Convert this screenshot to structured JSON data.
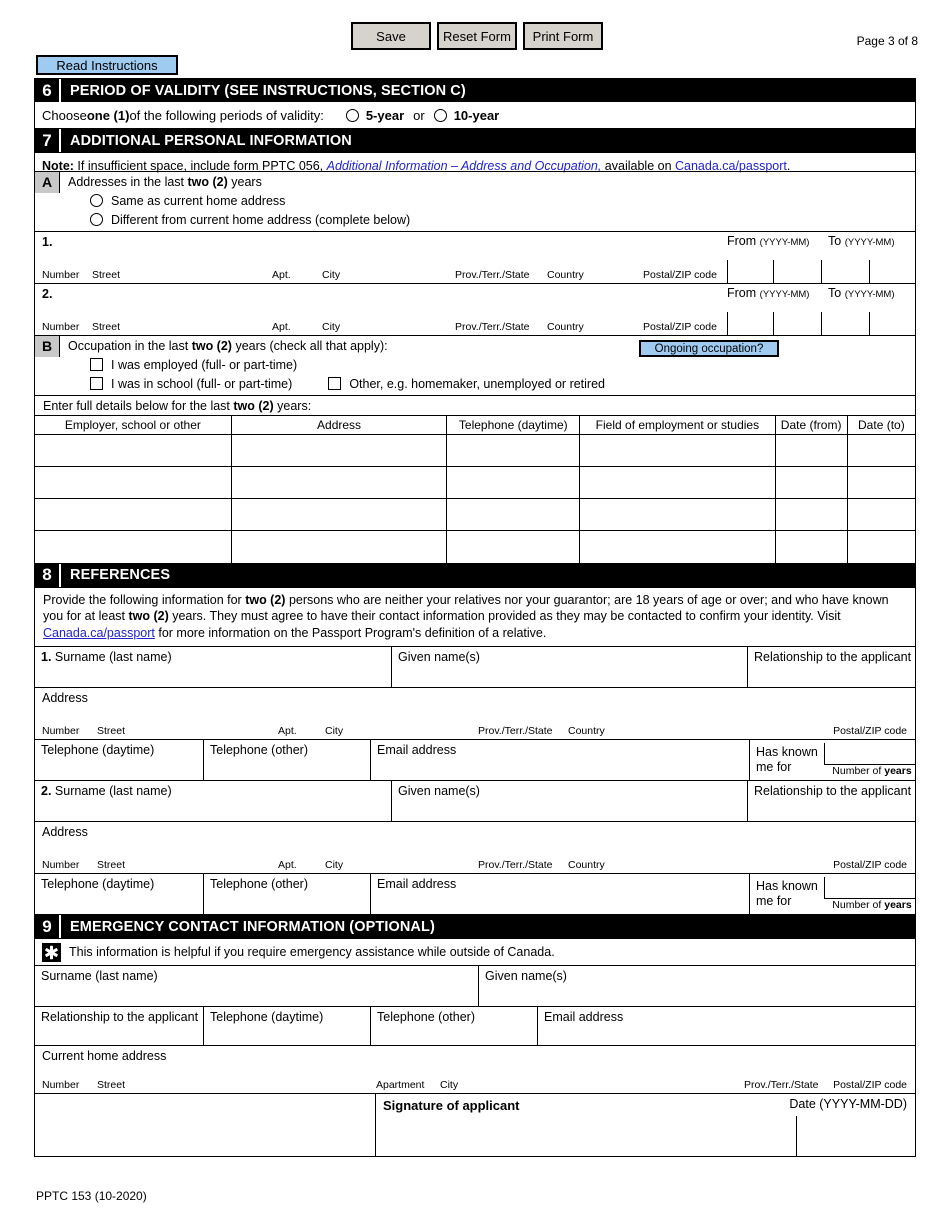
{
  "toolbar": {
    "save_label": "Save",
    "reset_label": "Reset Form",
    "print_label": "Print Form"
  },
  "header": {
    "page_indicator": "Page 3 of 8",
    "read_instructions_label": "Read Instructions"
  },
  "section6": {
    "number": "6",
    "title": "PERIOD OF VALIDITY (SEE INSTRUCTIONS, SECTION C)",
    "choose_prefix": "Choose ",
    "choose_bold": "one (1)",
    "choose_suffix": " of the following periods of validity:",
    "option_5year": "5-year",
    "or_label": "or",
    "option_10year": "10-year"
  },
  "section7": {
    "number": "7",
    "title": "ADDITIONAL PERSONAL INFORMATION",
    "note_label": "Note:",
    "note_text_1": " If insufficient space, include form PPTC 056, ",
    "note_form_title": "Additional Information – Address and Occupation,",
    "note_text_2": " available on ",
    "note_link": "Canada.ca/passport",
    "note_period": ".",
    "blockA": {
      "letter": "A",
      "heading_prefix": "Addresses in the last ",
      "heading_bold": "two (2)",
      "heading_suffix": " years",
      "option_same": "Same as current home address",
      "option_different": "Different from current home address (complete below)"
    },
    "address_rows": [
      {
        "index": "1.",
        "from_label": "From",
        "from_format": "(YYYY-MM)",
        "to_label": "To",
        "to_format": "(YYYY-MM)"
      },
      {
        "index": "2.",
        "from_label": "From",
        "from_format": "(YYYY-MM)",
        "to_label": "To",
        "to_format": "(YYYY-MM)"
      }
    ],
    "address_sublabels": {
      "number": "Number",
      "street": "Street",
      "apt": "Apt.",
      "city": "City",
      "prov": "Prov./Terr./State",
      "country": "Country",
      "postal": "Postal/ZIP code"
    },
    "blockB": {
      "letter": "B",
      "heading_prefix": "Occupation in the last ",
      "heading_bold": "two (2)",
      "heading_suffix": " years (check all that apply):",
      "ongoing_button": "Ongoing occupation?",
      "check_employed": "I was employed (full- or part-time)",
      "check_school": "I was in school (full- or part-time)",
      "check_other": "Other, e.g. homemaker, unemployed or retired"
    },
    "details_prefix": "Enter full details below for the last ",
    "details_bold": "two (2)",
    "details_suffix": " years:",
    "employment_table": {
      "headers": [
        "Employer, school or other",
        "Address",
        "Telephone (daytime)",
        "Field of employment or studies",
        "Date (from)",
        "Date (to)"
      ],
      "row_count": 4
    }
  },
  "section8": {
    "number": "8",
    "title": "REFERENCES",
    "intro_a": "Provide the following information for ",
    "intro_bold1": "two (2)",
    "intro_b": " persons who are neither your relatives nor your guarantor; are 18 years of age or over; and who have known you for at least ",
    "intro_bold2": "two (2)",
    "intro_c": " years. They must agree to have their contact information provided as they may be contacted to confirm your identity. Visit ",
    "intro_link": "Canada.ca/passport",
    "intro_d": " for more information on the Passport Program's definition of a relative.",
    "references": [
      {
        "surname_label": "1. Surname (last name)",
        "surname_index": "1.",
        "surname_text": " Surname (last name)",
        "given_label": "Given name(s)",
        "relationship_label": "Relationship to the applicant",
        "address_label": "Address",
        "telephone_daytime_label": "Telephone (daytime)",
        "telephone_other_label": "Telephone (other)",
        "email_label": "Email address",
        "known_label_line1": "Has known",
        "known_label_line2": "me for",
        "known_caption_prefix": "Number of ",
        "known_caption_bold": "years"
      },
      {
        "surname_label": "2. Surname (last name)",
        "surname_index": "2.",
        "surname_text": " Surname (last name)",
        "given_label": "Given name(s)",
        "relationship_label": "Relationship to the applicant",
        "address_label": "Address",
        "telephone_daytime_label": "Telephone (daytime)",
        "telephone_other_label": "Telephone (other)",
        "email_label": "Email address",
        "known_label_line1": "Has known",
        "known_label_line2": "me for",
        "known_caption_prefix": "Number of ",
        "known_caption_bold": "years"
      }
    ],
    "address_sublabels": {
      "number": "Number",
      "street": "Street",
      "apt": "Apt.",
      "city": "City",
      "prov": "Prov./Terr./State",
      "country": "Country",
      "postal": "Postal/ZIP code"
    }
  },
  "section9": {
    "number": "9",
    "title": "EMERGENCY CONTACT INFORMATION (OPTIONAL)",
    "icon": "star-of-life-icon",
    "helper_text": "This information is helpful if you require emergency assistance while outside of Canada.",
    "surname_label": "Surname (last name)",
    "given_label": "Given name(s)",
    "relationship_label": "Relationship to the applicant",
    "telephone_daytime_label": "Telephone (daytime)",
    "telephone_other_label": "Telephone (other)",
    "email_label": "Email address",
    "current_address_label": "Current home address",
    "address_sublabels": {
      "number": "Number",
      "street": "Street",
      "apartment": "Apartment",
      "city": "City",
      "prov": "Prov./Terr./State",
      "postal": "Postal/ZIP code"
    }
  },
  "signature": {
    "label": "Signature of applicant",
    "date_label": "Date ",
    "date_format": "(YYYY-MM-DD)"
  },
  "footer": {
    "form_code": "PPTC 153 (10-2020)"
  },
  "colors": {
    "section_header_bg": "#000000",
    "button_blue": "#9fcbf0",
    "button_grey": "#d6d3cc",
    "letter_badge_grey": "#c8c8c8",
    "link_blue": "#2222cc"
  }
}
